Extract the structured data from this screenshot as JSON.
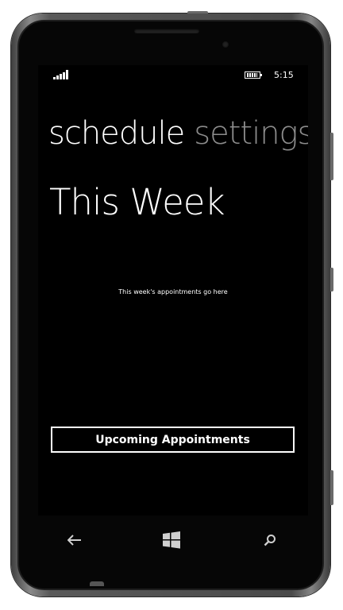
{
  "status_bar": {
    "time": "5:15",
    "signal_icon": "signal-icon",
    "battery_icon": "battery-icon"
  },
  "pivot": {
    "items": [
      {
        "label": "schedule",
        "active": true
      },
      {
        "label": "settings",
        "active": false
      }
    ]
  },
  "content": {
    "title": "This Week",
    "placeholder": "This week's appointments go here",
    "button_label": "Upcoming Appointments"
  },
  "nav_bar": {
    "back_icon": "back-arrow-icon",
    "start_icon": "windows-logo-icon",
    "search_icon": "search-icon"
  },
  "colors": {
    "screen_background": "#000000",
    "foreground": "#ffffff",
    "inactive_pivot": "#8c8c8c",
    "phone_frame": "#5a5a5a"
  }
}
